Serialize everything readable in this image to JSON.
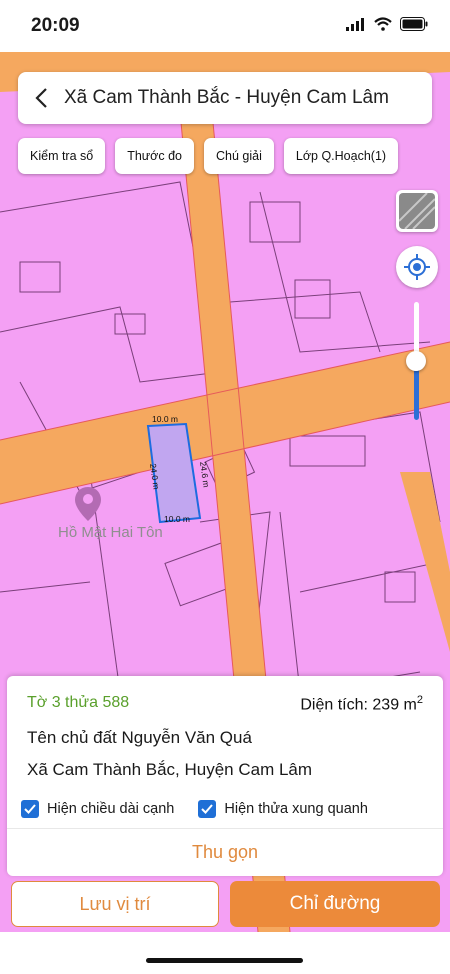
{
  "status": {
    "time": "20:09"
  },
  "header": {
    "title": "Xã Cam Thành Bắc - Huyện Cam Lâm"
  },
  "toolbar": {
    "chips": [
      "Kiểm tra sổ",
      "Thước đo",
      "Chú giải",
      "Lớp Q.Hoạch(1)"
    ]
  },
  "map": {
    "poi_label": "Hồ Mật Hai Tôn",
    "dimensions": [
      "10.0 m",
      "24.6 m",
      "24.0 m",
      "10.0 m"
    ],
    "colors": {
      "residential": "#f4a0f4",
      "road": "#f5a85f",
      "selected_parcel": "#c1a6f0"
    },
    "zoom_level": 0.5
  },
  "parcel": {
    "id_label": "Tờ 3 thửa 588",
    "area_label": "Diện tích: 239 m",
    "area_unit_sup": "2",
    "owner_label": "Tên chủ đất Nguyễn Văn Quá",
    "address": "Xã Cam Thành Bắc, Huyện Cam Lâm"
  },
  "options": {
    "show_edge_length": "Hiện chiều dài cạnh",
    "show_neighbors": "Hiện thửa xung quanh"
  },
  "panel": {
    "collapse_label": "Thu gọn"
  },
  "actions": {
    "save_location": "Lưu vị trí",
    "directions": "Chỉ đường"
  }
}
